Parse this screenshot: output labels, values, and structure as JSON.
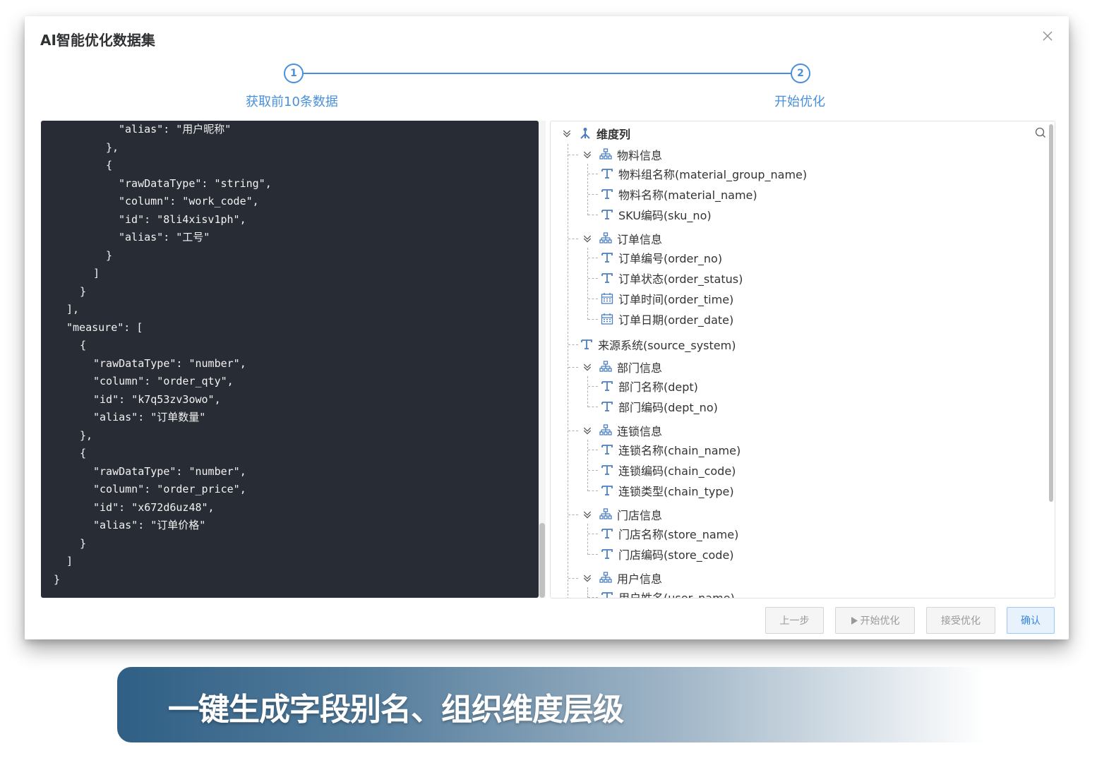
{
  "dialog": {
    "title": "AI智能优化数据集",
    "close_icon": "close-icon"
  },
  "steps": [
    {
      "number": "1",
      "label": "获取前10条数据"
    },
    {
      "number": "2",
      "label": "开始优化"
    }
  ],
  "code_lines": [
    "        \"alias\": \"用户昵称\"",
    "      },",
    "      {",
    "        \"rawDataType\": \"string\",",
    "        \"column\": \"work_code\",",
    "        \"id\": \"8li4xisv1ph\",",
    "        \"alias\": \"工号\"",
    "      }",
    "    ]",
    "  }",
    "],",
    "\"measure\": [",
    "  {",
    "    \"rawDataType\": \"number\",",
    "    \"column\": \"order_qty\",",
    "    \"id\": \"k7q53zv3owo\",",
    "    \"alias\": \"订单数量\"",
    "  },",
    "  {",
    "    \"rawDataType\": \"number\",",
    "    \"column\": \"order_price\",",
    "    \"id\": \"x672d6uz48\",",
    "    \"alias\": \"订单价格\"",
    "  }",
    "]",
    "}"
  ],
  "tree": {
    "root": "维度列",
    "groups": [
      {
        "label": "物料信息",
        "children": [
          {
            "label": "物料组名称(material_group_name)",
            "type": "text"
          },
          {
            "label": "物料名称(material_name)",
            "type": "text"
          },
          {
            "label": "SKU编码(sku_no)",
            "type": "text"
          }
        ]
      },
      {
        "label": "订单信息",
        "children": [
          {
            "label": "订单编号(order_no)",
            "type": "text"
          },
          {
            "label": "订单状态(order_status)",
            "type": "text"
          },
          {
            "label": "订单时间(order_time)",
            "type": "date"
          },
          {
            "label": "订单日期(order_date)",
            "type": "date"
          }
        ]
      },
      {
        "label": "来源系统(source_system)",
        "type": "text",
        "leaf": true
      },
      {
        "label": "部门信息",
        "children": [
          {
            "label": "部门名称(dept)",
            "type": "text"
          },
          {
            "label": "部门编码(dept_no)",
            "type": "text"
          }
        ]
      },
      {
        "label": "连锁信息",
        "children": [
          {
            "label": "连锁名称(chain_name)",
            "type": "text"
          },
          {
            "label": "连锁编码(chain_code)",
            "type": "text"
          },
          {
            "label": "连锁类型(chain_type)",
            "type": "text"
          }
        ]
      },
      {
        "label": "门店信息",
        "children": [
          {
            "label": "门店名称(store_name)",
            "type": "text"
          },
          {
            "label": "门店编码(store_code)",
            "type": "text"
          }
        ]
      },
      {
        "label": "用户信息",
        "children": [
          {
            "label": "用户姓名(user_name)",
            "type": "text"
          }
        ]
      }
    ]
  },
  "buttons": {
    "prev": "上一步",
    "start": "开始优化",
    "accept": "接受优化",
    "confirm": "确认"
  },
  "banner": {
    "text": "一键生成字段别名、组织维度层级"
  },
  "colors": {
    "accent": "#4a90d9",
    "code_bg": "#282c34",
    "banner_start": "#2f5f85"
  }
}
